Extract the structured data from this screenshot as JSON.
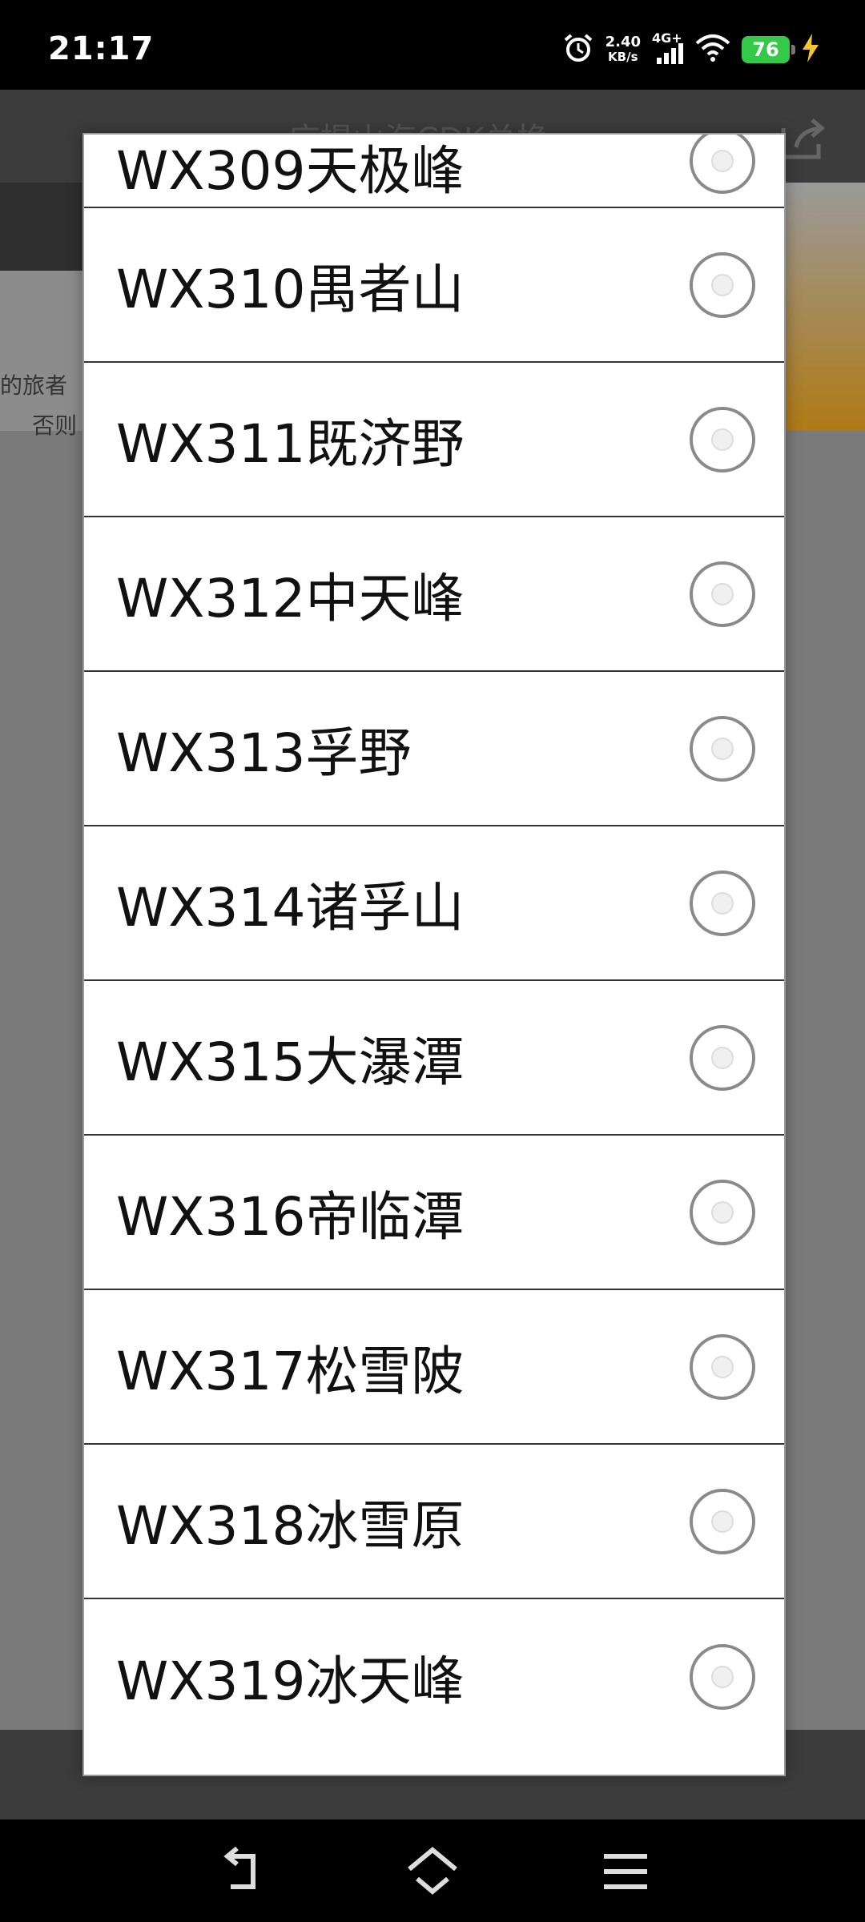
{
  "status_bar": {
    "time": "21:17",
    "net_speed_value": "2.40",
    "net_speed_unit": "KB/s",
    "network": "4G+",
    "battery": "76"
  },
  "background_app": {
    "title": "应提山海CDK兑换",
    "banner_text_1": "的旅者",
    "banner_text_2": "否则"
  },
  "dialog": {
    "items": [
      {
        "label": "WX309天极峰",
        "selected": false
      },
      {
        "label": "WX310禺者山",
        "selected": false
      },
      {
        "label": "WX311既济野",
        "selected": false
      },
      {
        "label": "WX312中天峰",
        "selected": false
      },
      {
        "label": "WX313孚野",
        "selected": false
      },
      {
        "label": "WX314诸孚山",
        "selected": false
      },
      {
        "label": "WX315大瀑潭",
        "selected": false
      },
      {
        "label": "WX316帝临潭",
        "selected": false
      },
      {
        "label": "WX317松雪陂",
        "selected": false
      },
      {
        "label": "WX318冰雪原",
        "selected": false
      },
      {
        "label": "WX319冰天峰",
        "selected": false
      }
    ]
  },
  "colors": {
    "dialog_bg": "#ffffff",
    "divider": "#333333",
    "scrim": "#7a7a7a",
    "battery": "#35c94a"
  },
  "icons": {
    "alarm": "alarm-icon",
    "wifi": "wifi-icon",
    "charging": "lightning-icon",
    "back": "back-icon",
    "home": "home-icon",
    "menu": "menu-icon"
  }
}
